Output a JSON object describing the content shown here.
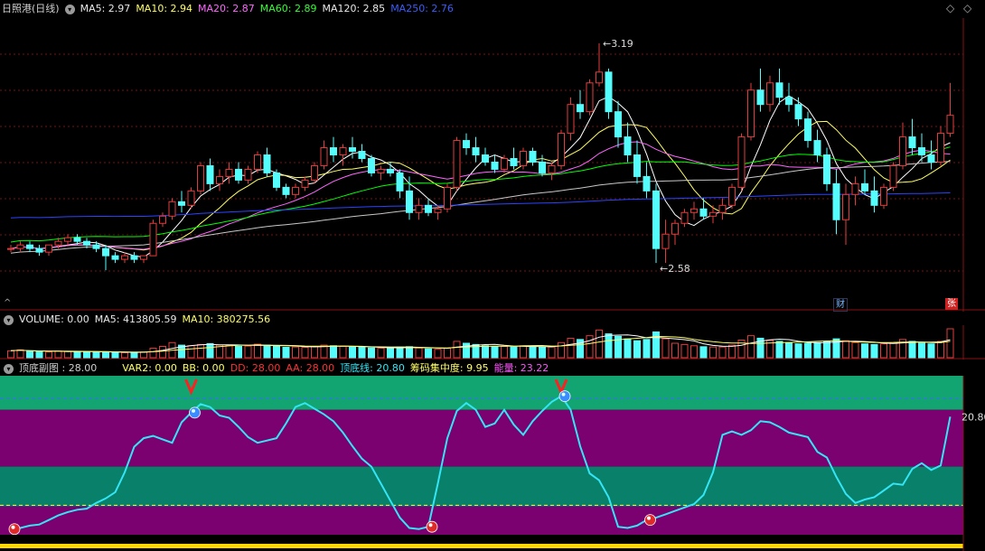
{
  "colors": {
    "up": "#e23b3b",
    "down": "#54fcfc",
    "ma5": "#ffffff",
    "ma10": "#ffff66",
    "ma20": "#ff66ff",
    "ma60": "#00ff00",
    "ma120": "#c8c8c8",
    "ma250": "#2a44ff",
    "band_green": "#12a571",
    "band_purple": "#7b0070",
    "band_green_mid": "#08806a",
    "line_cyan": "#33e5f5",
    "grid_red": "#7a0f0f"
  },
  "icons": [
    "collapse-icon",
    "diamond-icon",
    "up-caret-icon"
  ],
  "header": {
    "stock": "日照港(日线)",
    "ma_items": [
      {
        "label": "MA5: 2.97",
        "color": "#e8e8e8"
      },
      {
        "label": "MA10: 2.94",
        "color": "#ffff66"
      },
      {
        "label": "MA20: 2.87",
        "color": "#ff66ff"
      },
      {
        "label": "MA60: 2.89",
        "color": "#33ff33"
      },
      {
        "label": "MA120: 2.85",
        "color": "#e8e8e8"
      },
      {
        "label": "MA250: 2.76",
        "color": "#3b5cff"
      }
    ]
  },
  "volume_header": {
    "items": [
      {
        "label": "VOLUME: 0.00",
        "color": "#e8e8e8"
      },
      {
        "label": "MA5: 413805.59",
        "color": "#e8e8e8"
      },
      {
        "label": "MA10: 380275.56",
        "color": "#ffff66"
      }
    ]
  },
  "indicator_header": {
    "title": "顶底副图 : 28.00",
    "items": [
      {
        "label": "VAR2: 0.00",
        "color": "#ffff66"
      },
      {
        "label": "BB: 0.00",
        "color": "#ffff66"
      },
      {
        "label": "DD: 28.00",
        "color": "#ff3030"
      },
      {
        "label": "AA: 28.00",
        "color": "#ff3030"
      },
      {
        "label": "顶底线: 20.80",
        "color": "#33e5f5"
      },
      {
        "label": "筹码集中度: 9.95",
        "color": "#ffff66"
      },
      {
        "label": "能量: 23.22",
        "color": "#ff55ff"
      }
    ]
  },
  "badges": {
    "cai": "财",
    "zhang": "张"
  },
  "chart_data": [
    {
      "type": "candlestick",
      "title": "日照港(日线)",
      "ylim": [
        2.5,
        3.25
      ],
      "annotations": [
        {
          "label": "3.19",
          "value": 3.19
        },
        {
          "label": "2.58",
          "value": 2.58
        }
      ],
      "candles": [
        [
          2.62,
          2.63,
          2.61,
          2.62
        ],
        [
          2.62,
          2.64,
          2.61,
          2.63
        ],
        [
          2.63,
          2.64,
          2.61,
          2.62
        ],
        [
          2.62,
          2.63,
          2.6,
          2.61
        ],
        [
          2.61,
          2.63,
          2.6,
          2.63
        ],
        [
          2.63,
          2.65,
          2.62,
          2.64
        ],
        [
          2.64,
          2.66,
          2.63,
          2.65
        ],
        [
          2.65,
          2.66,
          2.63,
          2.64
        ],
        [
          2.64,
          2.65,
          2.62,
          2.63
        ],
        [
          2.63,
          2.64,
          2.61,
          2.62
        ],
        [
          2.62,
          2.63,
          2.56,
          2.6
        ],
        [
          2.6,
          2.61,
          2.58,
          2.59
        ],
        [
          2.59,
          2.61,
          2.58,
          2.6
        ],
        [
          2.6,
          2.61,
          2.58,
          2.59
        ],
        [
          2.59,
          2.6,
          2.58,
          2.6
        ],
        [
          2.6,
          2.7,
          2.6,
          2.69
        ],
        [
          2.69,
          2.72,
          2.68,
          2.71
        ],
        [
          2.71,
          2.76,
          2.7,
          2.75
        ],
        [
          2.75,
          2.78,
          2.72,
          2.74
        ],
        [
          2.74,
          2.79,
          2.73,
          2.78
        ],
        [
          2.78,
          2.86,
          2.77,
          2.85
        ],
        [
          2.85,
          2.87,
          2.78,
          2.8
        ],
        [
          2.8,
          2.84,
          2.78,
          2.82
        ],
        [
          2.82,
          2.86,
          2.8,
          2.84
        ],
        [
          2.84,
          2.86,
          2.8,
          2.81
        ],
        [
          2.81,
          2.85,
          2.8,
          2.84
        ],
        [
          2.84,
          2.89,
          2.83,
          2.88
        ],
        [
          2.88,
          2.9,
          2.82,
          2.83
        ],
        [
          2.83,
          2.84,
          2.78,
          2.79
        ],
        [
          2.79,
          2.8,
          2.76,
          2.77
        ],
        [
          2.77,
          2.8,
          2.76,
          2.79
        ],
        [
          2.79,
          2.82,
          2.78,
          2.81
        ],
        [
          2.81,
          2.86,
          2.8,
          2.85
        ],
        [
          2.85,
          2.92,
          2.84,
          2.9
        ],
        [
          2.9,
          2.93,
          2.86,
          2.88
        ],
        [
          2.88,
          2.91,
          2.85,
          2.9
        ],
        [
          2.9,
          2.93,
          2.87,
          2.89
        ],
        [
          2.89,
          2.91,
          2.86,
          2.87
        ],
        [
          2.87,
          2.88,
          2.82,
          2.83
        ],
        [
          2.83,
          2.85,
          2.81,
          2.84
        ],
        [
          2.84,
          2.86,
          2.82,
          2.83
        ],
        [
          2.83,
          2.84,
          2.76,
          2.78
        ],
        [
          2.78,
          2.82,
          2.7,
          2.72
        ],
        [
          2.72,
          2.76,
          2.7,
          2.74
        ],
        [
          2.74,
          2.76,
          2.71,
          2.72
        ],
        [
          2.72,
          2.74,
          2.7,
          2.73
        ],
        [
          2.73,
          2.8,
          2.72,
          2.79
        ],
        [
          2.79,
          2.93,
          2.78,
          2.92
        ],
        [
          2.92,
          2.94,
          2.88,
          2.9
        ],
        [
          2.9,
          2.93,
          2.86,
          2.88
        ],
        [
          2.88,
          2.9,
          2.85,
          2.86
        ],
        [
          2.86,
          2.88,
          2.83,
          2.84
        ],
        [
          2.84,
          2.88,
          2.83,
          2.87
        ],
        [
          2.87,
          2.9,
          2.84,
          2.85
        ],
        [
          2.85,
          2.9,
          2.84,
          2.89
        ],
        [
          2.89,
          2.9,
          2.85,
          2.86
        ],
        [
          2.86,
          2.88,
          2.82,
          2.83
        ],
        [
          2.83,
          2.86,
          2.81,
          2.85
        ],
        [
          2.85,
          2.95,
          2.84,
          2.94
        ],
        [
          2.94,
          3.04,
          2.92,
          3.02
        ],
        [
          3.02,
          3.06,
          2.98,
          3.0
        ],
        [
          3.0,
          3.09,
          2.99,
          3.08
        ],
        [
          3.08,
          3.19,
          3.07,
          3.11
        ],
        [
          3.11,
          3.12,
          2.98,
          3.0
        ],
        [
          3.0,
          3.03,
          2.9,
          2.93
        ],
        [
          2.93,
          2.97,
          2.86,
          2.88
        ],
        [
          2.88,
          2.92,
          2.8,
          2.82
        ],
        [
          2.82,
          2.86,
          2.76,
          2.78
        ],
        [
          2.78,
          2.8,
          2.58,
          2.62
        ],
        [
          2.62,
          2.7,
          2.58,
          2.66
        ],
        [
          2.66,
          2.7,
          2.63,
          2.69
        ],
        [
          2.69,
          2.73,
          2.68,
          2.72
        ],
        [
          2.72,
          2.75,
          2.7,
          2.73
        ],
        [
          2.73,
          2.76,
          2.7,
          2.71
        ],
        [
          2.71,
          2.74,
          2.69,
          2.72
        ],
        [
          2.72,
          2.76,
          2.7,
          2.74
        ],
        [
          2.74,
          2.8,
          2.73,
          2.79
        ],
        [
          2.79,
          2.94,
          2.78,
          2.93
        ],
        [
          2.93,
          3.08,
          2.92,
          3.06
        ],
        [
          3.06,
          3.12,
          3.0,
          3.02
        ],
        [
          3.02,
          3.1,
          3.0,
          3.08
        ],
        [
          3.08,
          3.12,
          3.02,
          3.04
        ],
        [
          3.04,
          3.08,
          3.0,
          3.02
        ],
        [
          3.02,
          3.04,
          2.96,
          2.98
        ],
        [
          2.98,
          3.0,
          2.9,
          2.92
        ],
        [
          2.92,
          2.95,
          2.86,
          2.88
        ],
        [
          2.88,
          2.9,
          2.78,
          2.8
        ],
        [
          2.8,
          2.84,
          2.66,
          2.7
        ],
        [
          2.7,
          2.8,
          2.63,
          2.77
        ],
        [
          2.77,
          2.82,
          2.74,
          2.8
        ],
        [
          2.8,
          2.84,
          2.77,
          2.78
        ],
        [
          2.78,
          2.82,
          2.72,
          2.74
        ],
        [
          2.74,
          2.8,
          2.73,
          2.79
        ],
        [
          2.79,
          2.86,
          2.78,
          2.85
        ],
        [
          2.85,
          2.97,
          2.84,
          2.93
        ],
        [
          2.93,
          2.98,
          2.88,
          2.9
        ],
        [
          2.9,
          2.94,
          2.86,
          2.88
        ],
        [
          2.88,
          2.92,
          2.84,
          2.86
        ],
        [
          2.86,
          2.96,
          2.85,
          2.94
        ],
        [
          2.94,
          3.08,
          2.93,
          2.99
        ]
      ],
      "ma_series": [
        {
          "name": "MA5",
          "color": "#ffffff",
          "window": 5
        },
        {
          "name": "MA10",
          "color": "#ffff66",
          "window": 10
        },
        {
          "name": "MA20",
          "color": "#ff66ff",
          "window": 20
        },
        {
          "name": "MA60",
          "color": "#00ff00",
          "window": 60
        },
        {
          "name": "MA120",
          "color": "#c8c8c8",
          "window": 120
        },
        {
          "name": "MA250",
          "color": "#2a44ff",
          "window": 250
        }
      ]
    },
    {
      "type": "bar",
      "title": "VOLUME",
      "values": [
        22,
        25,
        20,
        19,
        18,
        21,
        20,
        19,
        18,
        17,
        19,
        17,
        16,
        16,
        18,
        30,
        36,
        48,
        40,
        38,
        42,
        45,
        40,
        39,
        36,
        37,
        43,
        40,
        37,
        33,
        34,
        33,
        36,
        40,
        38,
        36,
        34,
        33,
        31,
        30,
        30,
        34,
        35,
        31,
        28,
        27,
        30,
        52,
        46,
        42,
        38,
        35,
        36,
        34,
        38,
        35,
        33,
        34,
        48,
        62,
        58,
        70,
        88,
        76,
        68,
        60,
        54,
        58,
        82,
        60,
        46,
        42,
        38,
        35,
        34,
        34,
        40,
        56,
        70,
        62,
        55,
        52,
        48,
        44,
        46,
        48,
        52,
        60,
        54,
        48,
        44,
        42,
        44,
        48,
        58,
        52,
        46,
        44,
        52,
        92
      ]
    },
    {
      "type": "line",
      "title": "顶底副图",
      "ylim": [
        0,
        28
      ],
      "ticks": [
        "20.80"
      ],
      "series": [
        {
          "name": "顶底线",
          "color": "#33e5f5",
          "values": [
            1,
            1.2,
            1.6,
            1.8,
            2.6,
            3.4,
            4,
            4.4,
            4.6,
            5.6,
            6.4,
            7.5,
            11,
            15.5,
            17,
            17.4,
            16.8,
            16.2,
            19.8,
            21.5,
            23,
            22.5,
            21,
            20.6,
            19,
            17.2,
            16.2,
            16.6,
            17,
            19.6,
            22.5,
            23.2,
            22.2,
            21.2,
            20,
            18,
            15.6,
            13.4,
            12,
            9,
            6,
            3,
            1.2,
            1,
            1.4,
            9,
            17,
            21.8,
            23.2,
            22,
            19,
            19.6,
            22,
            19.4,
            17.6,
            20,
            21.8,
            23.4,
            24.4,
            22,
            15.6,
            10.8,
            9.6,
            6.6,
            1.4,
            1.2,
            1.6,
            2.6,
            3,
            3.6,
            4.2,
            4.8,
            5.4,
            7,
            11,
            17.6,
            18.2,
            17.6,
            18.4,
            20,
            19.8,
            19,
            18,
            17.6,
            17.2,
            14.6,
            13.6,
            10.2,
            7.2,
            5.6,
            6.2,
            6.6,
            7.8,
            9,
            8.8,
            11.6,
            12.6,
            11.4,
            12.2,
            20.8
          ]
        }
      ],
      "markers": {
        "top_triangles": [
          19,
          58
        ],
        "blue_balls": [
          19,
          58
        ],
        "red_balls": [
          0,
          44,
          67
        ]
      }
    }
  ]
}
